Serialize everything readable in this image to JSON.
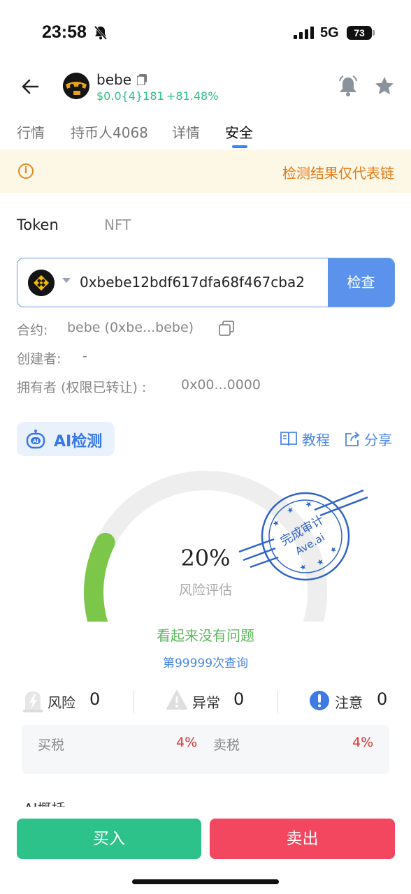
{
  "status_bar": {
    "time": "23:58",
    "network": "5G",
    "battery": "73"
  },
  "header": {
    "token_name": "bebe",
    "price": "$0.0{4}181",
    "change": "+81.48%",
    "icons": [
      "back-arrow-icon",
      "copy-icon",
      "alert-bell-icon",
      "star-icon"
    ]
  },
  "tabs": [
    {
      "label": "行情",
      "active": false
    },
    {
      "label": "持币人4068",
      "active": false
    },
    {
      "label": "详情",
      "active": false
    },
    {
      "label": "安全",
      "active": true
    }
  ],
  "notice": {
    "text": "检测结果仅代表链"
  },
  "toggle": {
    "token": "Token",
    "nft": "NFT"
  },
  "search": {
    "address": "0xbebe12bdf617dfa68f467cba2",
    "check_label": "检查"
  },
  "contract_info": {
    "contract_label": "合约:",
    "contract_value": "bebe (0xbe...bebe)",
    "creator_label": "创建者:",
    "creator_value": "-",
    "owner_label": "拥有者 (权限已转让) :",
    "owner_value": "0x00...0000"
  },
  "ai_section": {
    "detect_label": "AI检测",
    "tutorial_label": "教程",
    "share_label": "分享"
  },
  "gauge": {
    "risk_percent": "20%",
    "risk_label": "风险评估",
    "risk_fraction": 0.2,
    "stamp_top": "完成审计",
    "stamp_bottom": "Ave.ai",
    "result_text": "看起来没有问题",
    "query_count": "第99999次查询",
    "colors": {
      "fill": "#7cc74a",
      "track": "#eeeeee",
      "stamp": "#2f63c8"
    }
  },
  "stats": [
    {
      "label": "风险",
      "value": "0",
      "icon": "lightning-icon"
    },
    {
      "label": "异常",
      "value": "0",
      "icon": "warning-icon"
    },
    {
      "label": "注意",
      "value": "0",
      "icon": "exclamation-icon"
    }
  ],
  "tax": {
    "buy_label": "买税",
    "buy_value": "4%",
    "sell_label": "卖税",
    "sell_value": "4%"
  },
  "summary_peek": "AI概括",
  "actions": {
    "buy_label": "买入",
    "sell_label": "卖出"
  }
}
